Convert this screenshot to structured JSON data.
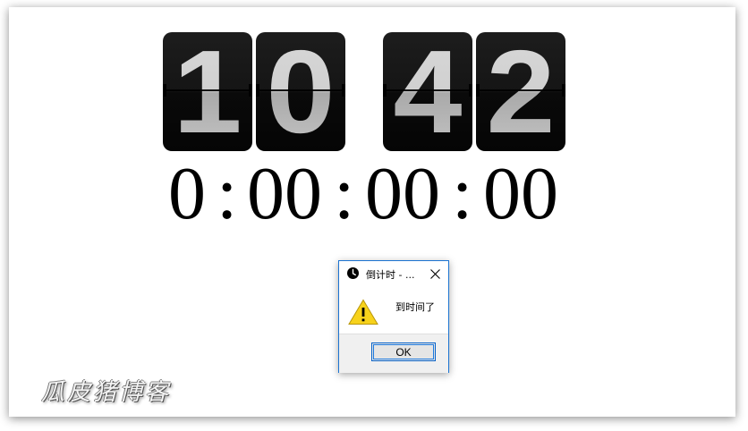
{
  "clock": {
    "hour_tens": "1",
    "hour_ones": "0",
    "minute_tens": "4",
    "minute_ones": "2"
  },
  "countdown": {
    "hours": "0",
    "minutes": "00",
    "seconds": "00",
    "fraction": "00",
    "separator": ":"
  },
  "dialog": {
    "title": "倒计时 - ...",
    "message": "到时间了",
    "ok_label": "OK",
    "title_icon": "clock-icon",
    "message_icon": "warning-icon",
    "close_icon": "close-icon"
  },
  "watermark": {
    "text": "瓜皮猪博客"
  },
  "colors": {
    "dialog_border": "#1b73d1",
    "warning_yellow": "#f7d21b",
    "digit_card": "#111111"
  }
}
